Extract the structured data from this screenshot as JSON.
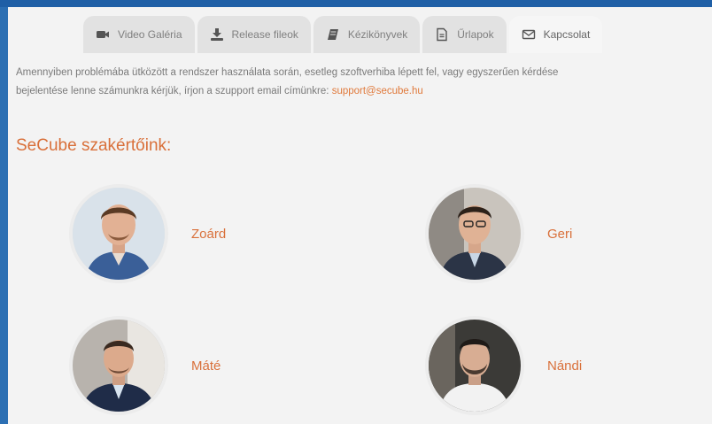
{
  "tabs": [
    {
      "label": "Video Galéria",
      "icon": "video-camera-icon"
    },
    {
      "label": "Release fileok",
      "icon": "download-icon"
    },
    {
      "label": "Kézikönyvek",
      "icon": "book-icon"
    },
    {
      "label": "Űrlapok",
      "icon": "document-icon"
    },
    {
      "label": "Kapcsolat",
      "icon": "envelope-icon",
      "active": true
    }
  ],
  "intro": {
    "line1": "Amennyiben problémába ütközött a rendszer használata során, esetleg  szoftverhiba lépett fel, vagy egyszerűen kérdése",
    "line2_prefix": "bejelentése lenne számunkra kérjük, írjon a szupport email címünkre: ",
    "email": "support@secube.hu"
  },
  "section_title": "SeCube szakértőink:",
  "experts": [
    {
      "name": "Zoárd"
    },
    {
      "name": "Geri"
    },
    {
      "name": "Máté"
    },
    {
      "name": "Nándi"
    }
  ],
  "colors": {
    "accent": "#d9703a",
    "link": "#e07a3c",
    "text": "#7a7a7a"
  }
}
